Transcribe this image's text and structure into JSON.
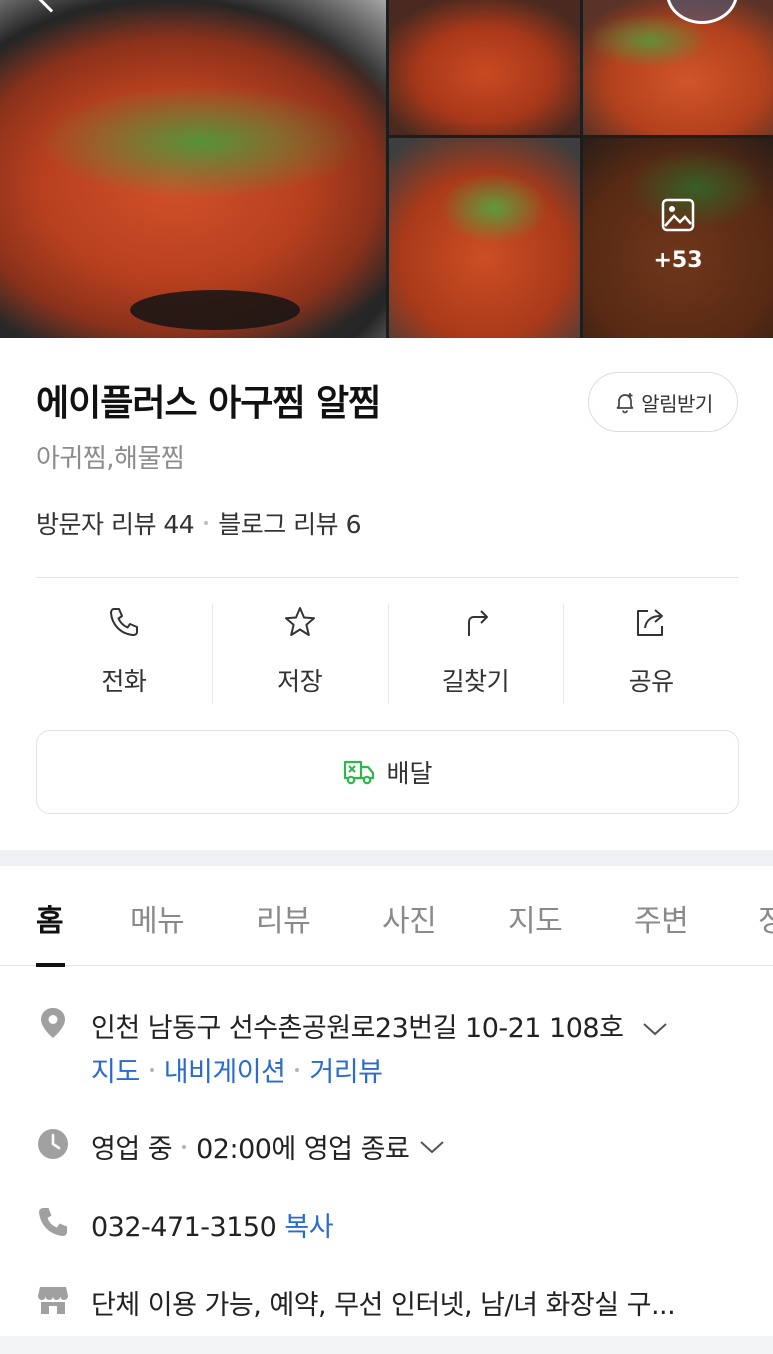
{
  "gallery": {
    "more_count": "+53",
    "icons": {
      "more": "image-icon",
      "back": "chevron-left-icon"
    }
  },
  "place": {
    "name": "에이플러스 아구찜 알찜",
    "category": "아귀찜,해물찜",
    "visitor_reviews_label": "방문자 리뷰",
    "visitor_reviews_count": "44",
    "blog_reviews_label": "블로그 리뷰",
    "blog_reviews_count": "6"
  },
  "notify": {
    "label": "알림받기",
    "icon": "bell-plus-icon"
  },
  "actions": [
    {
      "label": "전화",
      "icon": "phone-icon"
    },
    {
      "label": "저장",
      "icon": "star-icon"
    },
    {
      "label": "길찾기",
      "icon": "directions-icon"
    },
    {
      "label": "공유",
      "icon": "share-icon"
    }
  ],
  "delivery": {
    "label": "배달",
    "icon": "delivery-truck-icon",
    "icon_color": "#2db84b"
  },
  "tabs": [
    {
      "label": "홈",
      "active": true
    },
    {
      "label": "메뉴"
    },
    {
      "label": "리뷰"
    },
    {
      "label": "사진"
    },
    {
      "label": "지도"
    },
    {
      "label": "주변"
    },
    {
      "label": "정"
    }
  ],
  "info": {
    "address": "인천 남동구 선수촌공원로23번길 10-21 108호",
    "address_links": [
      "지도",
      "내비게이션",
      "거리뷰"
    ],
    "status": "영업 중",
    "hours": "02:00에 영업 종료",
    "phone": "032-471-3150",
    "copy_label": "복사",
    "amenities": "단체 이용 가능, 예약, 무선 인터넷, 남/녀 화장실 구..."
  },
  "colors": {
    "link": "#2a6bd1",
    "icon_gray": "#9a9a9a",
    "accent_green": "#2db84b"
  }
}
